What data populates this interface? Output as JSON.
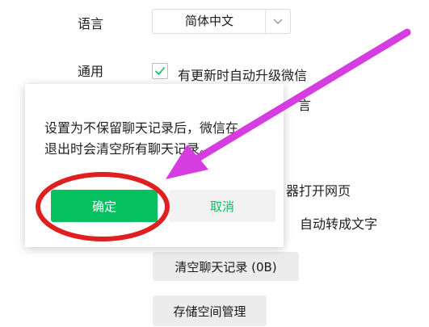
{
  "settings": {
    "language_label": "语言",
    "language_value": "简体中文",
    "general_label": "通用",
    "auto_upgrade_label": "有更新时自动升级微信",
    "option2_fragment": "言",
    "option3_fragment": "器打开网页",
    "option4_fragment": "自动转成文字",
    "clear_chat_button": "清空聊天记录 (0B)",
    "storage_button": "存储空间管理"
  },
  "dialog": {
    "message_line1": "设置为不保留聊天记录后，微信在",
    "message_line2": "退出时会清空所有聊天记录。",
    "confirm_label": "确定",
    "cancel_label": "取消"
  },
  "colors": {
    "accent_green": "#07c160",
    "annotation_red": "#e02020",
    "annotation_arrow": "#d63de0"
  },
  "annotations": {
    "circle_target": "confirm-button",
    "arrow_target": "confirm-button"
  }
}
